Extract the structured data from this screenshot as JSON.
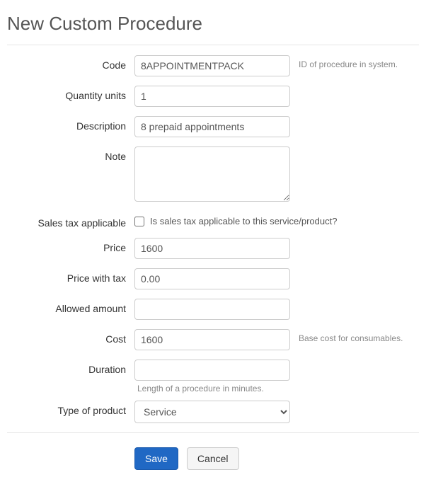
{
  "page": {
    "title": "New Custom Procedure"
  },
  "form": {
    "code": {
      "label": "Code",
      "value": "8APPOINTMENTPACK",
      "help": "ID of procedure in system."
    },
    "quantity_units": {
      "label": "Quantity units",
      "value": "1"
    },
    "description": {
      "label": "Description",
      "value": "8 prepaid appointments"
    },
    "note": {
      "label": "Note",
      "value": ""
    },
    "sales_tax": {
      "label": "Sales tax applicable",
      "checkbox_label": "Is sales tax applicable to this service/product?",
      "checked": false
    },
    "price": {
      "label": "Price",
      "value": "1600"
    },
    "price_with_tax": {
      "label": "Price with tax",
      "value": "0.00"
    },
    "allowed_amount": {
      "label": "Allowed amount",
      "value": ""
    },
    "cost": {
      "label": "Cost",
      "value": "1600",
      "help": "Base cost for consumables."
    },
    "duration": {
      "label": "Duration",
      "value": "",
      "below_help": "Length of a procedure in minutes."
    },
    "type_of_product": {
      "label": "Type of product",
      "value": "Service"
    }
  },
  "actions": {
    "save": "Save",
    "cancel": "Cancel"
  }
}
